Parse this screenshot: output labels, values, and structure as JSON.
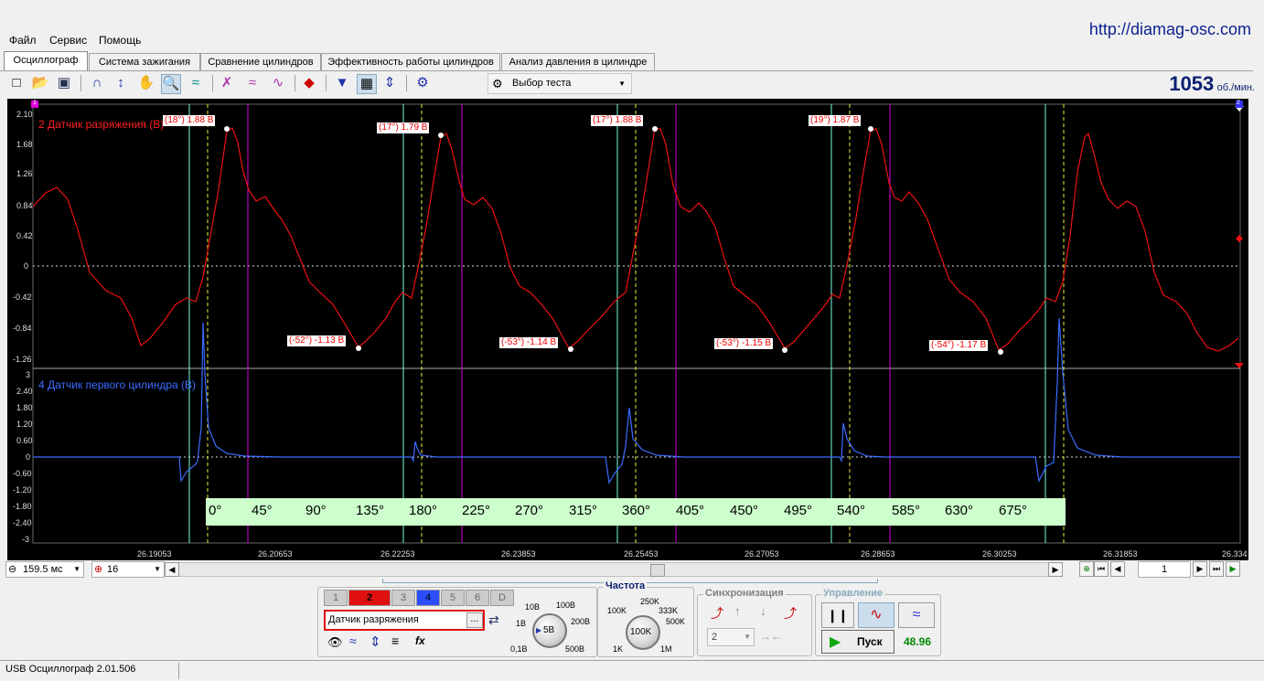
{
  "site_url": "http://diamag-osc.com",
  "menu": [
    "Файл",
    "Сервис",
    "Помощь"
  ],
  "tabs": [
    "Осциллограф",
    "Система зажигания",
    "Сравнение цилиндров",
    "Эффективность работы цилиндров",
    "Анализ давления в цилиндре"
  ],
  "toolbar": {
    "test_select": "Выбор теста",
    "rpm_value": "1053",
    "rpm_unit": "об./мин."
  },
  "scope": {
    "markers": {
      "left": "1",
      "right": "2"
    },
    "ch2": {
      "title": "2 Датчик разряжения (В)",
      "color": "#ff2020",
      "y_ticks": [
        "2.10",
        "1.68",
        "1.26",
        "0.84",
        "0.42",
        "0",
        "-0.42",
        "-0.84",
        "-1.26"
      ],
      "peaks": [
        "(18°) 1.88 В",
        "(17°) 1.79 В",
        "(17°) 1.88 В",
        "(19°) 1.87 В"
      ],
      "troughs": [
        "(-52°) -1.13 В",
        "(-53°) -1.14 В",
        "(-53°) -1.15 В",
        "(-54°) -1.17 В"
      ]
    },
    "ch4": {
      "title": "4 Датчик первого цилиндра (В)",
      "color": "#3b6cff",
      "y_ticks": [
        "3",
        "2.40",
        "1.80",
        "1.20",
        "0.60",
        "0",
        "-0.60",
        "-1.20",
        "-1.80",
        "-2.40",
        "-3"
      ]
    },
    "degrees": [
      "0°",
      "45°",
      "90°",
      "135°",
      "180°",
      "225°",
      "270°",
      "315°",
      "360°",
      "405°",
      "450°",
      "495°",
      "540°",
      "585°",
      "630°",
      "675°"
    ],
    "x_ticks": [
      "26.19053",
      "26.20653",
      "26.22253",
      "26.23853",
      "26.25453",
      "26.27053",
      "26.28653",
      "26.30253",
      "26.31853",
      "26.334"
    ]
  },
  "nav": {
    "timebase": "159.5 мс",
    "zoom": "16",
    "page": "1"
  },
  "channels_panel": {
    "buttons": [
      "1",
      "2",
      "3",
      "4",
      "5",
      "6",
      "D"
    ],
    "sensor": "Датчик разряжения",
    "dots": "...",
    "fx": "fx",
    "volt_knob": "5В",
    "volt_scale": [
      "0,1В",
      "1В",
      "10В",
      "100В",
      "200В",
      "500В"
    ]
  },
  "freq_panel": {
    "title": "Частота",
    "knob": "100K",
    "scale": [
      "1K",
      "100K",
      "250K",
      "333K",
      "500K",
      "1M"
    ]
  },
  "sync_panel": {
    "title": "Синхронизация",
    "channel": "2"
  },
  "control_panel": {
    "title": "Управление",
    "start": "Пуск",
    "value": "48.96"
  },
  "status": {
    "text": "USB Осциллограф  2.01.506"
  }
}
